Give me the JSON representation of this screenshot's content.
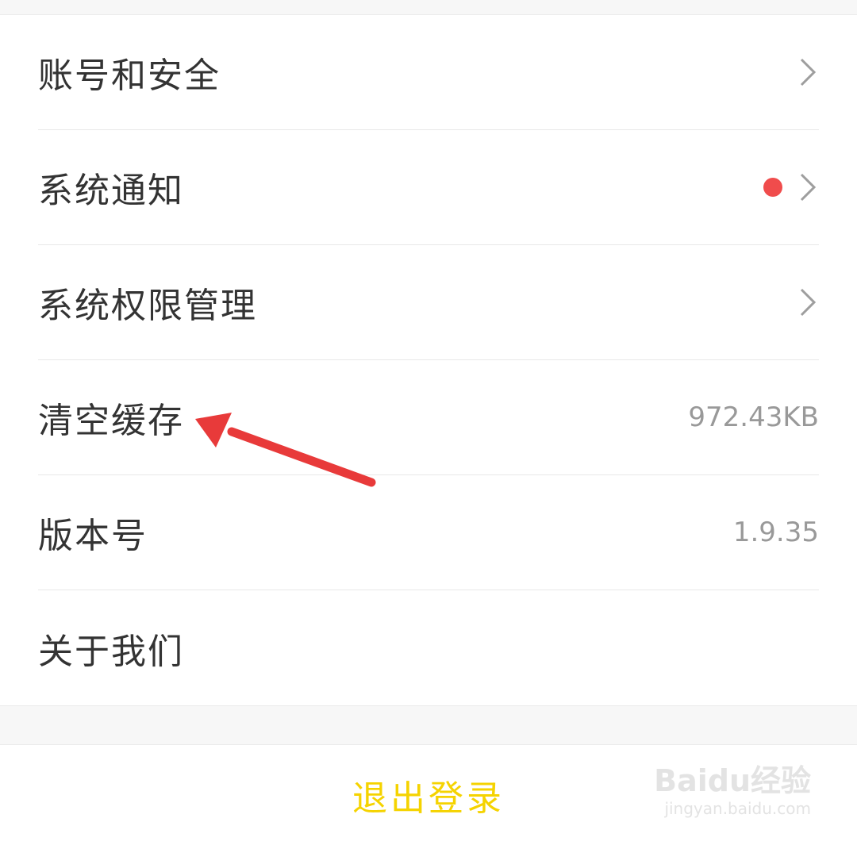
{
  "colors": {
    "background": "#ffffff",
    "label_text": "#333333",
    "value_text": "#999999",
    "notification_dot": "#f04c4c",
    "logout_text": "#f5d300",
    "arrow": "#e83a3a"
  },
  "settings": {
    "items": [
      {
        "label": "账号和安全",
        "value": "",
        "has_chevron": true,
        "has_dot": false
      },
      {
        "label": "系统通知",
        "value": "",
        "has_chevron": true,
        "has_dot": true
      },
      {
        "label": "系统权限管理",
        "value": "",
        "has_chevron": true,
        "has_dot": false
      },
      {
        "label": "清空缓存",
        "value": "972.43KB",
        "has_chevron": false,
        "has_dot": false
      },
      {
        "label": "版本号",
        "value": "1.9.35",
        "has_chevron": false,
        "has_dot": false
      },
      {
        "label": "关于我们",
        "value": "",
        "has_chevron": false,
        "has_dot": false
      }
    ]
  },
  "logout": {
    "label": "退出登录"
  },
  "icons": {
    "chevron": "chevron-right-icon",
    "dot": "notification-dot-icon",
    "arrow": "annotation-arrow-icon"
  },
  "watermark": {
    "logo": "Baidu经验",
    "url": "jingyan.baidu.com"
  }
}
